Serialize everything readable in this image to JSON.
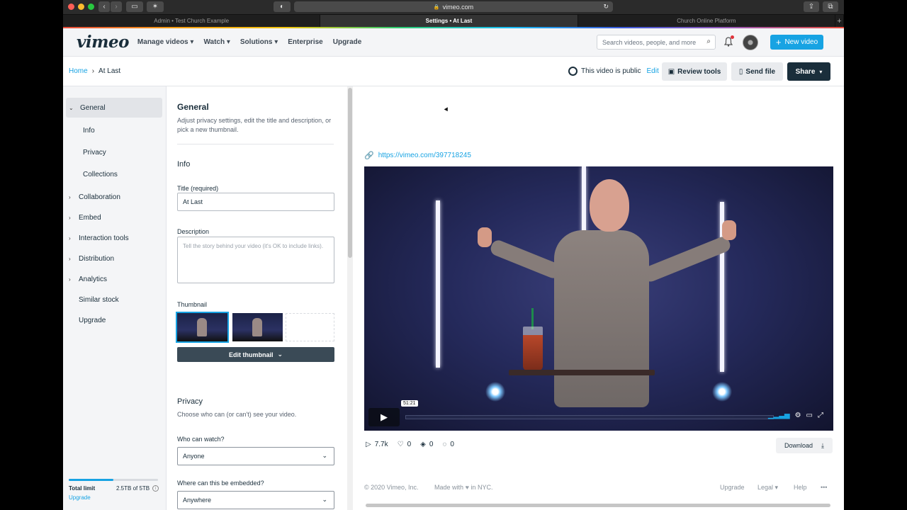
{
  "browser": {
    "url": "vimeo.com",
    "tabs": [
      "Admin • Test Church Example",
      "Settings • At Last",
      "Church Online Platform"
    ],
    "active_tab": 1
  },
  "nav": {
    "logo": "vimeo",
    "links": [
      "Manage videos",
      "Watch",
      "Solutions",
      "Enterprise",
      "Upgrade"
    ],
    "search_placeholder": "Search videos, people, and more",
    "new_video": "New video"
  },
  "breadcrumb": {
    "home": "Home",
    "current": "At Last"
  },
  "actions": {
    "public_text": "This video is public",
    "edit": "Edit",
    "review_tools": "Review tools",
    "send_file": "Send file",
    "share": "Share"
  },
  "sidebar": {
    "items": [
      {
        "label": "General",
        "chevron": "⌄",
        "level": "top",
        "active": true
      },
      {
        "label": "Info",
        "level": "sub"
      },
      {
        "label": "Privacy",
        "level": "sub"
      },
      {
        "label": "Collections",
        "level": "sub"
      },
      {
        "label": "Collaboration",
        "chevron": "›",
        "level": "top"
      },
      {
        "label": "Embed",
        "chevron": "›",
        "level": "top"
      },
      {
        "label": "Interaction tools",
        "chevron": "›",
        "level": "top"
      },
      {
        "label": "Distribution",
        "chevron": "›",
        "level": "top"
      },
      {
        "label": "Analytics",
        "chevron": "›",
        "level": "top"
      },
      {
        "label": "Similar stock",
        "level": "plain"
      },
      {
        "label": "Upgrade",
        "level": "plain"
      }
    ],
    "limit_label": "Total limit",
    "limit_value": "2.5TB of 5TB",
    "limit_fraction": 0.5,
    "limit_upgrade": "Upgrade"
  },
  "form": {
    "general_title": "General",
    "general_desc": "Adjust privacy settings, edit the title and description, or pick a new thumbnail.",
    "info_title": "Info",
    "title_label": "Title (required)",
    "title_value": "At Last",
    "description_label": "Description",
    "description_placeholder": "Tell the story behind your video (it's OK to include links).",
    "thumbnail_label": "Thumbnail",
    "edit_thumbnail": "Edit thumbnail",
    "privacy_title": "Privacy",
    "privacy_desc": "Choose who can (or can't) see your video.",
    "who_watch_label": "Who can watch?",
    "who_watch_value": "Anyone",
    "embed_label": "Where can this be embedded?",
    "embed_value": "Anywhere"
  },
  "preview": {
    "link": "https://vimeo.com/397718245",
    "time": "51:21",
    "stats": {
      "plays": "7.7k",
      "likes": "0",
      "collections": "0",
      "comments": "0"
    },
    "download": "Download"
  },
  "footer": {
    "copyright": "© 2020 Vimeo, Inc.",
    "made_with": "Made with",
    "in_nyc": "in NYC.",
    "links": [
      "Upgrade",
      "Legal",
      "Help",
      "•••"
    ]
  },
  "colors": {
    "accent": "#17a3e3",
    "dark": "#1a2e3b"
  }
}
